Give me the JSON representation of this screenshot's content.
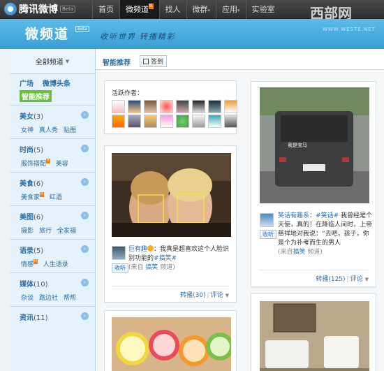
{
  "topnav": {
    "logo_text": "腾讯微博",
    "logo_beta": "Beta",
    "items": [
      {
        "label": "首页",
        "active": false
      },
      {
        "label": "微频道",
        "active": true,
        "hot": "H"
      },
      {
        "label": "找人",
        "active": false
      },
      {
        "label": "微群",
        "active": false,
        "caret": "▾"
      },
      {
        "label": "应用",
        "active": false,
        "caret": "▾"
      },
      {
        "label": "实验室",
        "active": false
      }
    ],
    "watermark": "西部网",
    "watermark_sub": "WWW.WESTE.NET"
  },
  "banner": {
    "title": "微频道",
    "beta": "Beta",
    "slogan": "收听世界 转播精彩"
  },
  "sidebar": {
    "all_channels": "全部频道",
    "top_links": [
      {
        "label": "广场"
      },
      {
        "label": "微博头条"
      }
    ],
    "selected": "智能推荐",
    "categories": [
      {
        "name": "美女",
        "count": "(3)",
        "subs": [
          {
            "label": "女神"
          },
          {
            "label": "真人秀"
          },
          {
            "label": "贴图"
          }
        ]
      },
      {
        "name": "时尚",
        "count": "(5)",
        "subs": [
          {
            "label": "服饰搭配",
            "hot": "H"
          },
          {
            "label": "美容"
          }
        ]
      },
      {
        "name": "美食",
        "count": "(6)",
        "subs": [
          {
            "label": "美食家",
            "hot": "H"
          },
          {
            "label": "红酒"
          }
        ]
      },
      {
        "name": "美图",
        "count": "(6)",
        "subs": [
          {
            "label": "摄影"
          },
          {
            "label": "旅行"
          },
          {
            "label": "全家福"
          }
        ]
      },
      {
        "name": "语录",
        "count": "(5)",
        "subs": [
          {
            "label": "情感",
            "hot": "H"
          },
          {
            "label": "人生语录"
          }
        ]
      },
      {
        "name": "媒体",
        "count": "(10)",
        "subs": [
          {
            "label": "杂谈"
          },
          {
            "label": "路边社"
          },
          {
            "label": "帮帮"
          }
        ]
      },
      {
        "name": "资讯",
        "count": "(11)",
        "subs": []
      }
    ]
  },
  "main": {
    "tab_recommend": "智能推荐",
    "sign_in": "签到",
    "active_authors_title": "活跃作者：",
    "posts": [
      {
        "author": "巨有趣",
        "text": "：我真是超喜欢这个人脸识别功能的",
        "tag": "#搞笑#",
        "source_prefix": "(来自",
        "source": "搞笑",
        "source_suffix": "频道)",
        "listen": "收听",
        "repost": "转播(30)",
        "comment": "评论"
      },
      {
        "author": "笑话有趣系",
        "text_pre": "：",
        "tag": "#笑话#",
        "text": " 我曾经是个天使，真的！在降临人间时，上帝慈祥地对我说：“去吧，孩子，你是个为补考而生的男人",
        "source_prefix": "(来自",
        "source": "搞笑",
        "source_suffix": "频道)",
        "listen": "收听",
        "repost": "转播(125)",
        "comment": "评论"
      }
    ]
  }
}
